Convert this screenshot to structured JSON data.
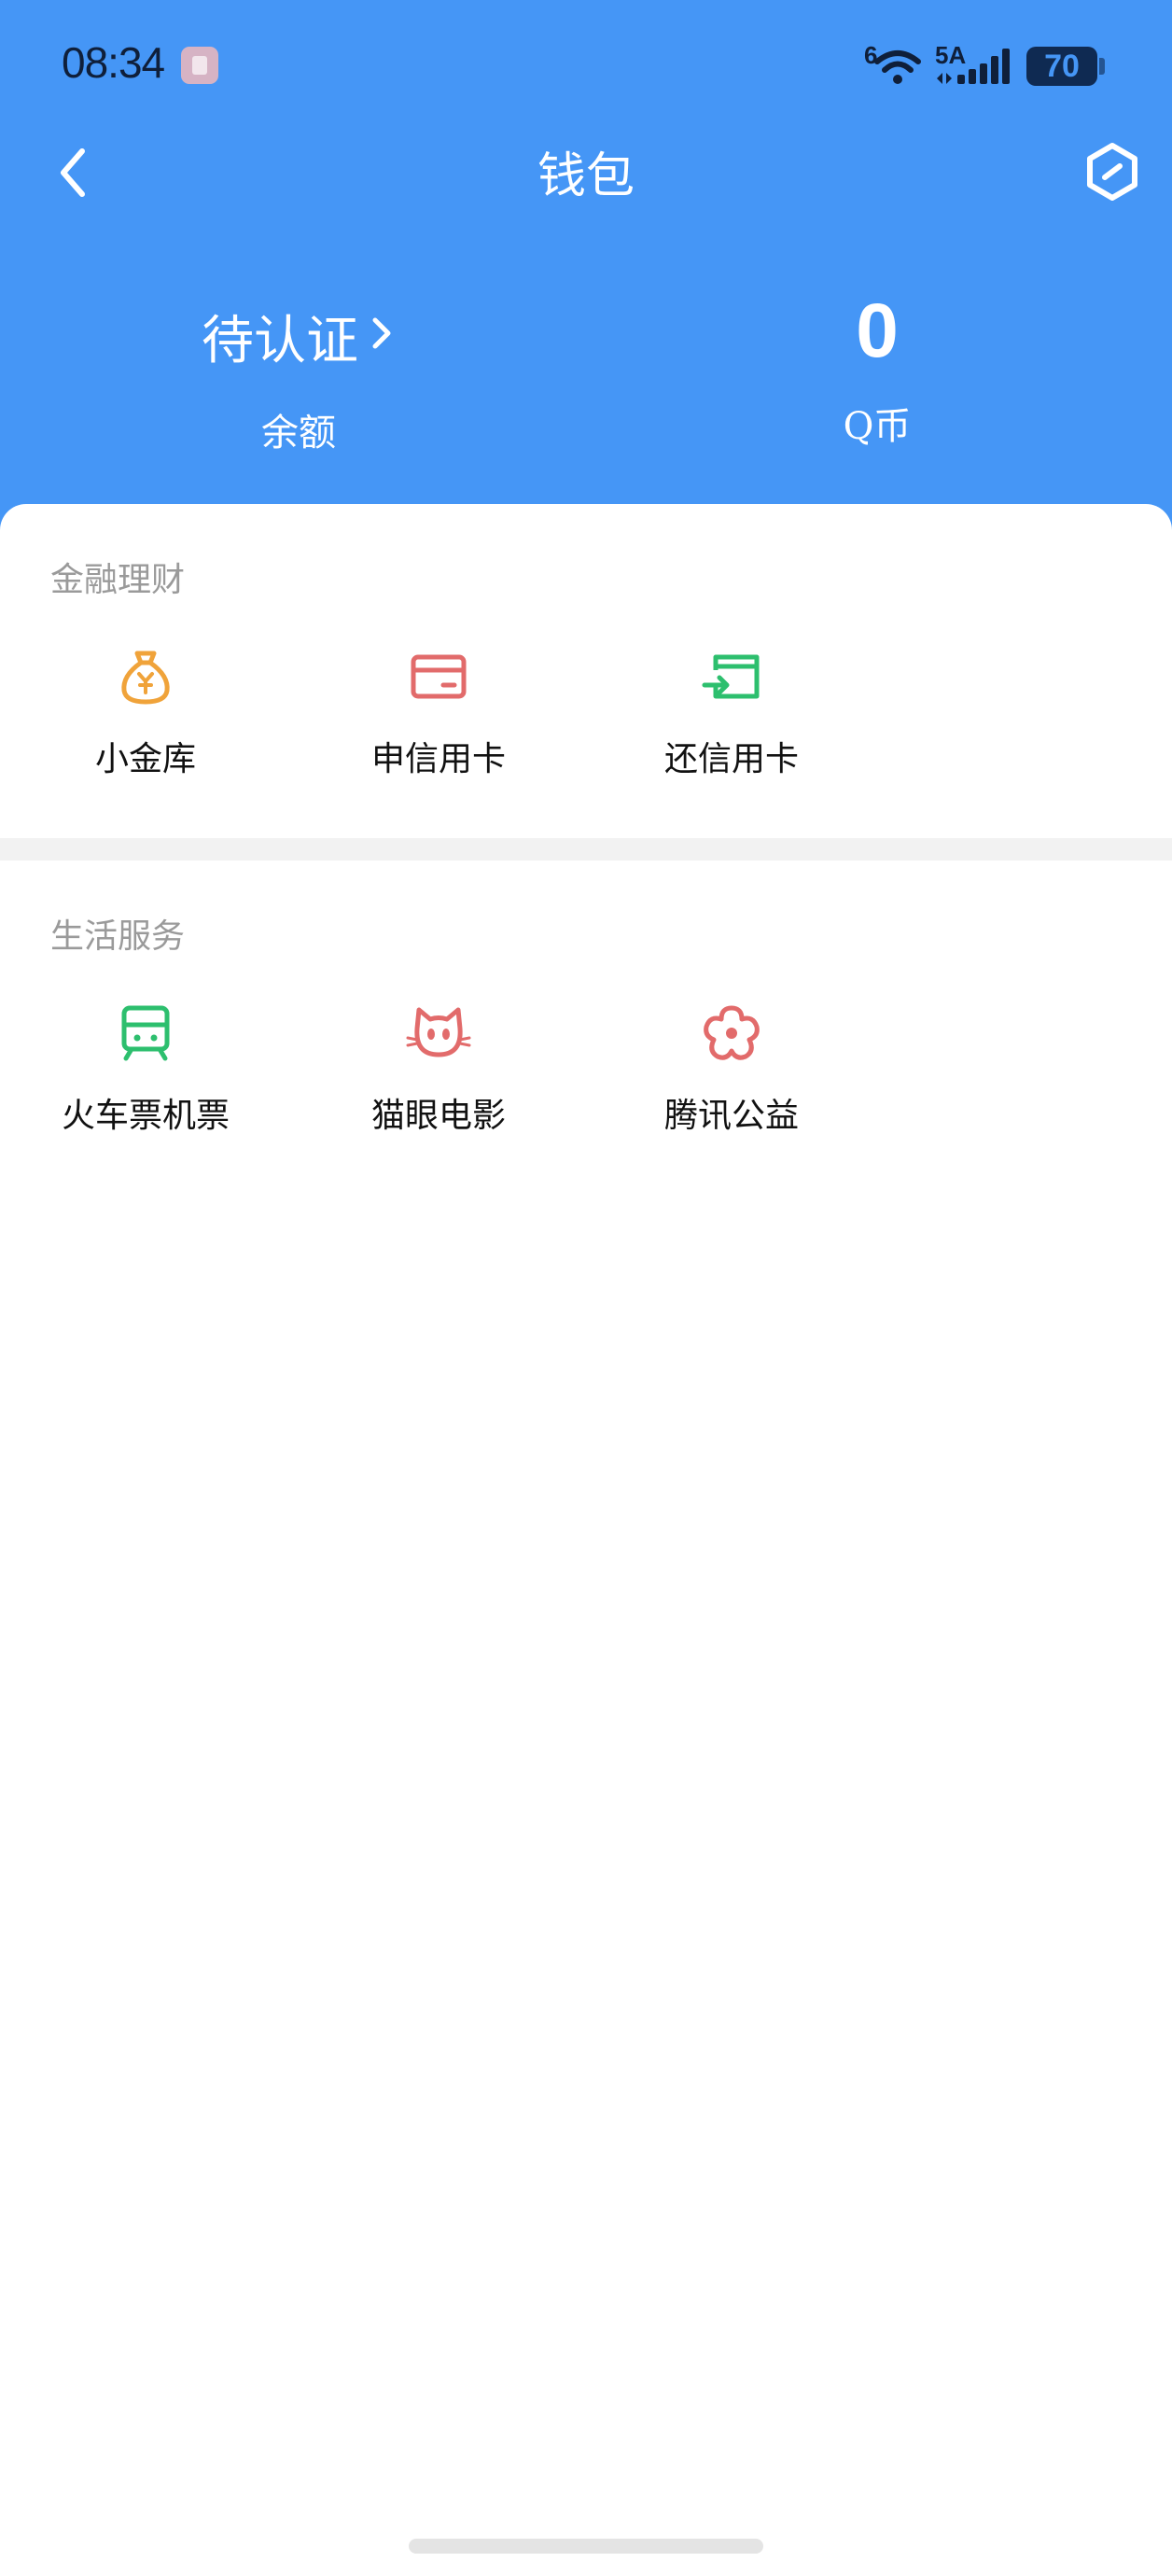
{
  "status_bar": {
    "time": "08:34",
    "wifi_generation": "6",
    "cell_generation": "5A",
    "battery": "70"
  },
  "nav": {
    "title": "钱包"
  },
  "summary": {
    "balance_value": "待认证",
    "balance_label": "余额",
    "qcoin_value": "0",
    "qcoin_label": "Q币"
  },
  "sections": [
    {
      "title": "金融理财",
      "items": [
        {
          "label": "小金库",
          "icon": "money-bag-icon",
          "color": "#F0A33A"
        },
        {
          "label": "申信用卡",
          "icon": "credit-card-icon",
          "color": "#E26B6B"
        },
        {
          "label": "还信用卡",
          "icon": "card-repay-icon",
          "color": "#2DBF6E"
        }
      ]
    },
    {
      "title": "生活服务",
      "items": [
        {
          "label": "火车票机票",
          "icon": "train-icon",
          "color": "#2DBF6E"
        },
        {
          "label": "猫眼电影",
          "icon": "cat-icon",
          "color": "#E26B6B"
        },
        {
          "label": "腾讯公益",
          "icon": "flower-icon",
          "color": "#E26B6B"
        }
      ]
    }
  ],
  "colors": {
    "header_bg": "#4596F6",
    "divider": "#F2F2F2",
    "section_title": "#9A9A9A"
  }
}
